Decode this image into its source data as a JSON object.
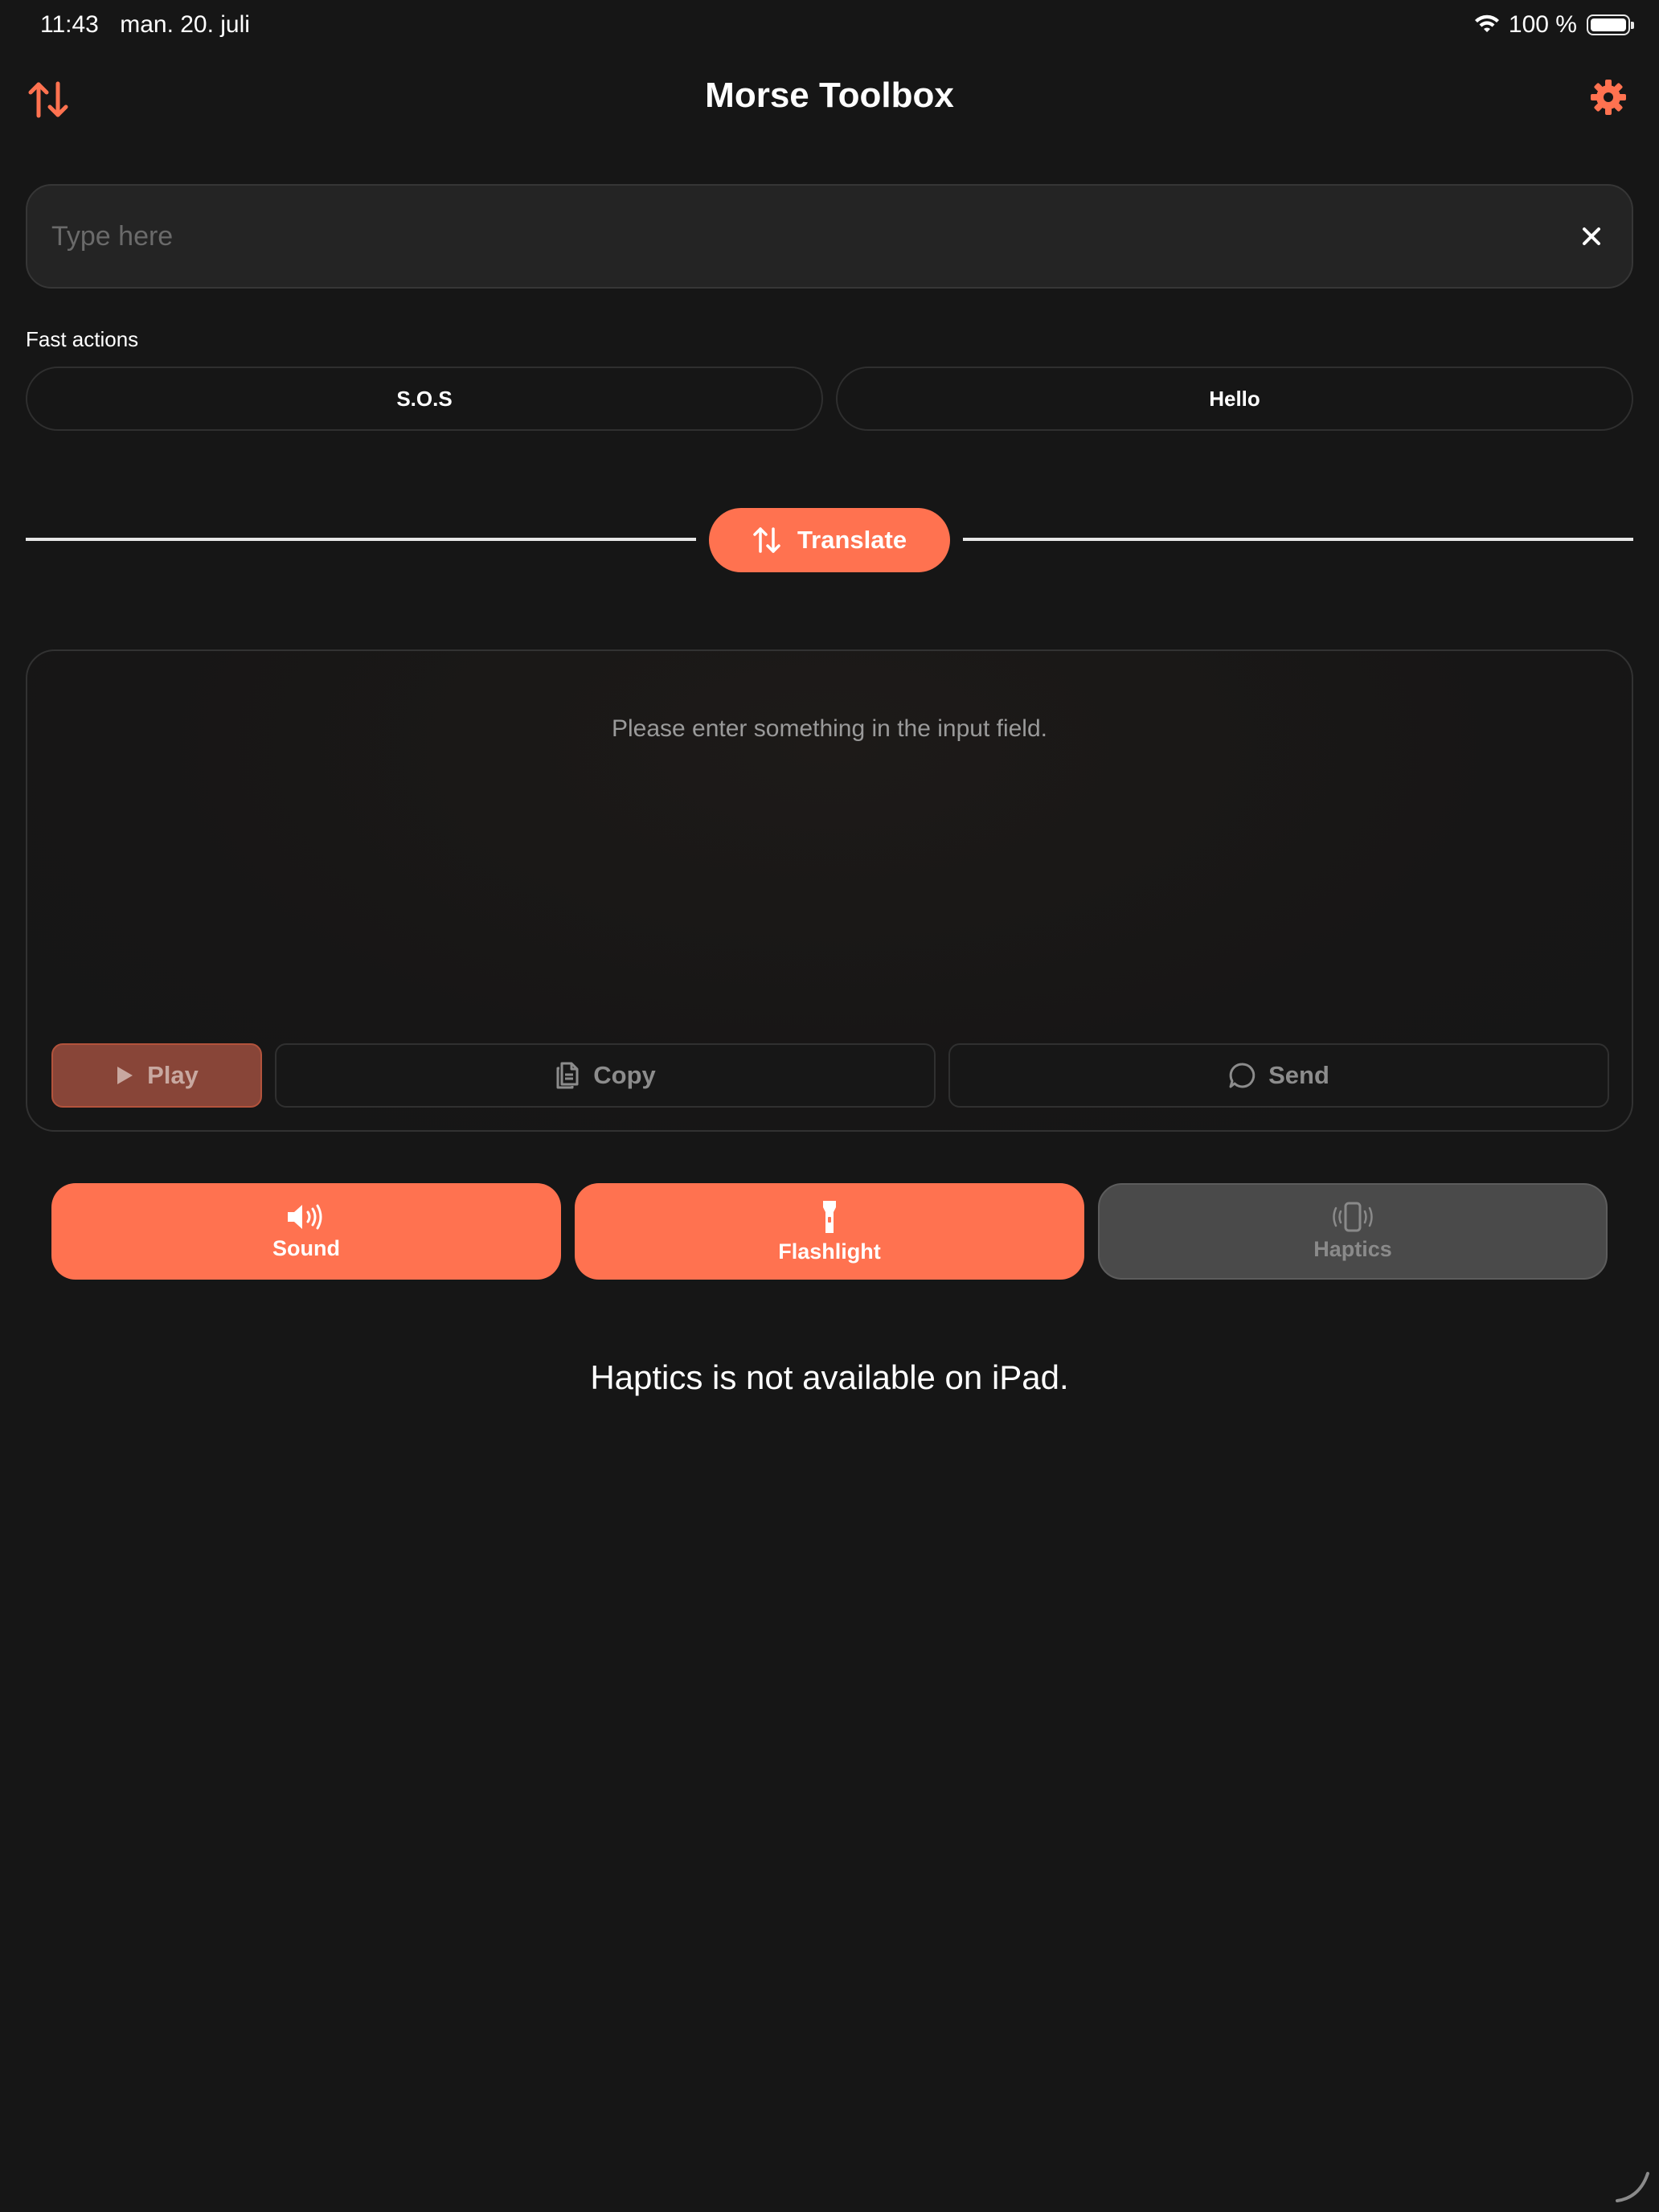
{
  "status_bar": {
    "time": "11:43",
    "date": "man. 20. juli",
    "battery_text": "100 %",
    "icons": [
      "wifi-icon",
      "battery-icon"
    ]
  },
  "nav": {
    "title": "Morse Toolbox",
    "left_icon": "swap-vertical-icon",
    "right_icon": "gear-icon"
  },
  "input": {
    "value": "",
    "placeholder": "Type here",
    "clear_icon": "close-icon"
  },
  "fast_actions": {
    "label": "Fast actions",
    "items": [
      {
        "label": "S.O.S"
      },
      {
        "label": "Hello"
      }
    ]
  },
  "translate": {
    "label": "Translate",
    "icon": "swap-vertical-icon"
  },
  "output": {
    "message": "Please enter something in the input field.",
    "actions": [
      {
        "label": "Play",
        "icon": "play-icon"
      },
      {
        "label": "Copy",
        "icon": "copy-icon"
      },
      {
        "label": "Send",
        "icon": "message-bubble-icon"
      }
    ]
  },
  "modes": [
    {
      "label": "Sound",
      "icon": "speaker-icon",
      "active": true
    },
    {
      "label": "Flashlight",
      "icon": "flashlight-icon",
      "active": true
    },
    {
      "label": "Haptics",
      "icon": "phone-vibrate-icon",
      "active": false
    }
  ],
  "haptics_note": "Haptics is not available on iPad.",
  "colors": {
    "accent": "#ff7250",
    "background": "#161616",
    "card_border": "#323232",
    "disabled": "#4a4a4a"
  }
}
